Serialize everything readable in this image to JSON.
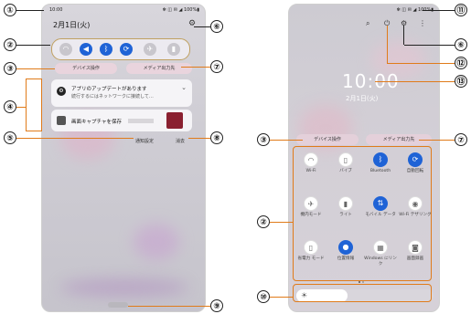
{
  "left_phone": {
    "status_time": "10:00",
    "status_right": "✻ ◫ ✉ ◢ 100%▮",
    "date": "2月1日(火)",
    "device_control": "デバイス操作",
    "media_output": "メディア出力先",
    "notification1_title": "アプリのアップデートがあります",
    "notification1_sub": "続行するにはネットワークに接続して…",
    "notification2_title": "画面キャプチャを保存",
    "notify_settings": "通知設定",
    "clear": "消去",
    "bottom_label": "..."
  },
  "right_phone": {
    "status_right": "✻ ◫ ✉ ◢ 100%▮",
    "clock": "10:00",
    "date": "2月1日(火)",
    "device_control": "デバイス操作",
    "media_output": "メディア出力先",
    "tiles": [
      {
        "label": "Wi-Fi",
        "state": "off",
        "icon": "wifi-icon"
      },
      {
        "label": "バイブ",
        "state": "off",
        "icon": "vibrate-icon"
      },
      {
        "label": "Bluetooth",
        "state": "on",
        "icon": "bluetooth-icon"
      },
      {
        "label": "自動回転",
        "state": "on",
        "icon": "rotate-icon"
      },
      {
        "label": "機内モード",
        "state": "off",
        "icon": "airplane-icon"
      },
      {
        "label": "ライト",
        "state": "off",
        "icon": "flashlight-icon"
      },
      {
        "label": "モバイル データ",
        "state": "on",
        "icon": "mobile-data-icon"
      },
      {
        "label": "Wi-Fi テザリング",
        "state": "off",
        "icon": "hotspot-icon"
      },
      {
        "label": "省電力 モード",
        "state": "off",
        "icon": "battery-icon"
      },
      {
        "label": "位置情報",
        "state": "on",
        "icon": "location-icon"
      },
      {
        "label": "Windows にリンク",
        "state": "off",
        "icon": "link-windows-icon"
      },
      {
        "label": "画面録画",
        "state": "off",
        "icon": "screen-record-icon"
      }
    ],
    "brightness_icon": "☀"
  },
  "callouts": [
    "①",
    "②",
    "③",
    "④",
    "⑤",
    "⑥",
    "⑦",
    "⑧",
    "⑨",
    "⑩",
    "⑪",
    "⑫",
    "⑬"
  ],
  "colors": {
    "accent_blue": "#1f63d6",
    "callout_line": "#e07b1a"
  }
}
